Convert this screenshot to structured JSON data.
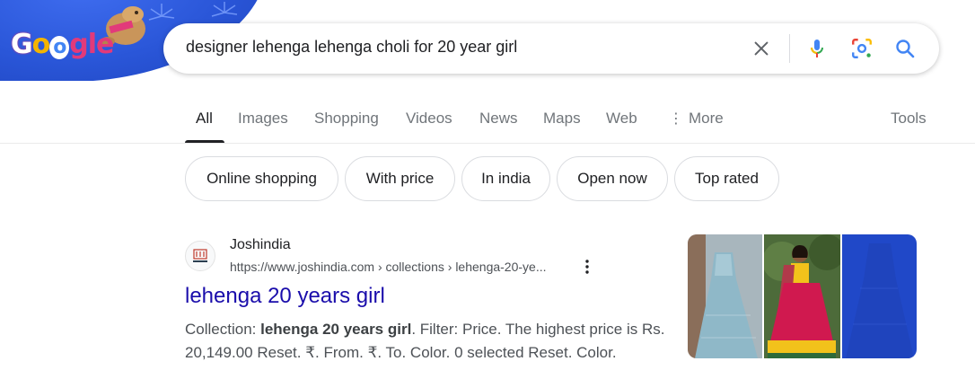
{
  "search": {
    "query": "designer lehenga lehenga choli for 20 year girl"
  },
  "icons": {
    "clear": "close-icon",
    "mic": "mic-icon",
    "lens": "lens-icon",
    "search": "search-icon"
  },
  "tabs": [
    {
      "label": "All",
      "active": true
    },
    {
      "label": "Images"
    },
    {
      "label": "Shopping"
    },
    {
      "label": "Videos"
    },
    {
      "label": "News"
    },
    {
      "label": "Maps"
    },
    {
      "label": "Web"
    },
    {
      "label": "More"
    }
  ],
  "tools_label": "Tools",
  "chips": [
    "Online shopping",
    "With price",
    "In india",
    "Open now",
    "Top rated"
  ],
  "result": {
    "site_name": "Joshindia",
    "url": "https://www.joshindia.com › collections › lehenga-20-ye...",
    "title": "lehenga 20 years girl",
    "snippet_1": "Collection: ",
    "snippet_bold": "lehenga 20 years girl",
    "snippet_2": ". Filter: Price. The highest price is Rs. 20,149.00 Reset. ₹. From. ₹. To. Color. 0 selected Reset. Color."
  },
  "colors": {
    "link": "#1a0dab",
    "doodle_blue": "#2a56d8"
  }
}
